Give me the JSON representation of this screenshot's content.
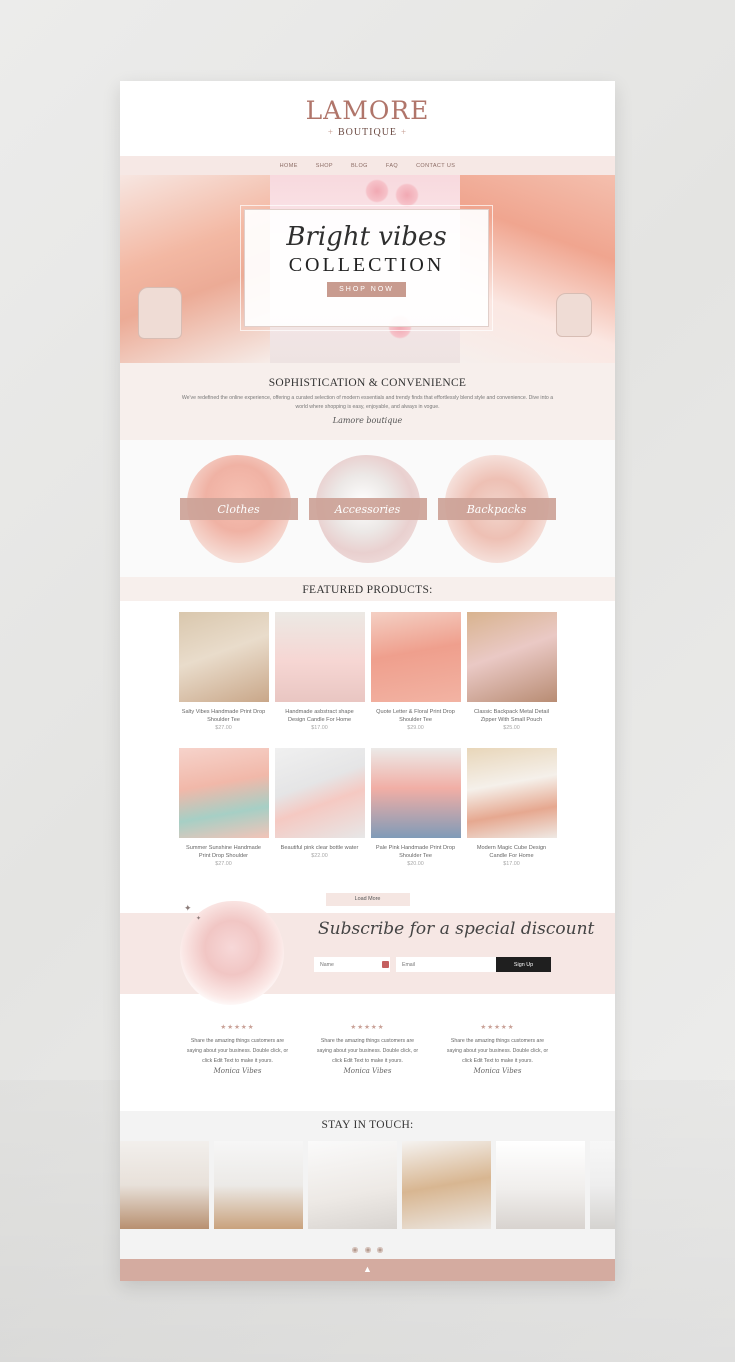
{
  "brand": {
    "name": "LAMORE",
    "sub": "BOUTIQUE",
    "spark": "+"
  },
  "nav": {
    "items": [
      "HOME",
      "SHOP",
      "BLOG",
      "FAQ",
      "CONTACT US"
    ]
  },
  "hero": {
    "script": "Bright vibes",
    "title": "COLLECTION",
    "button": "SHOP NOW"
  },
  "intro": {
    "title": "SOPHISTICATION & CONVENIENCE",
    "text": "We've redefined the online experience, offering a curated selection of modern essentials and trendy finds that effortlessly blend style and convenience. Dive into a world where shopping is easy, enjoyable, and always in vogue.",
    "sign": "Lamore boutique"
  },
  "categories": [
    "Clothes",
    "Accessories",
    "Backpacks"
  ],
  "featured": {
    "title": "FEATURED PRODUCTS:",
    "products": [
      {
        "name": "Salty Vibes Handmade Print Drop Shoulder Tee",
        "price": "$27.00"
      },
      {
        "name": "Handmade asbstract shape Design Candle For Home",
        "price": "$17.00"
      },
      {
        "name": "Quote Letter & Floral Print Drop Shoulder Tee",
        "price": "$29.00"
      },
      {
        "name": "Classic Backpack Metal Detail Zipper With Small Pouch",
        "price": "$25.00"
      },
      {
        "name": "Summer Sunshine Handmade Print Drop Shoulder",
        "price": "$27.00"
      },
      {
        "name": "Beautiful pink clear bottle water",
        "price": "$22.00"
      },
      {
        "name": "Pale Pink Handmade Print Drop Shoulder Tee",
        "price": "$20.00"
      },
      {
        "name": "Modern Magic Cube Design Candle For Home",
        "price": "$17.00"
      }
    ],
    "load_more": "Load More"
  },
  "subscribe": {
    "title": "Subscribe for a special discount",
    "name_placeholder": "Name",
    "email_placeholder": "Email",
    "button": "Sign Up"
  },
  "testimonials": [
    {
      "stars": "★★★★★",
      "text": "Share the amazing things customers are saying about your business. Double click, or click Edit Text to make it yours.",
      "sign": "Monica Vibes"
    },
    {
      "stars": "★★★★★",
      "text": "Share the amazing things customers are saying about your business. Double click, or click Edit Text to make it yours.",
      "sign": "Monica Vibes"
    },
    {
      "stars": "★★★★★",
      "text": "Share the amazing things customers are saying about your business. Double click, or click Edit Text to make it yours.",
      "sign": "Monica Vibes"
    }
  ],
  "touch": {
    "title": "STAY IN TOUCH:"
  },
  "footer": {
    "up_icon": "▲"
  },
  "colors": {
    "accent": "#c89b8f",
    "blush": "#f6e8e5",
    "footer": "#d4aba0",
    "dark": "#1f1f1f"
  }
}
